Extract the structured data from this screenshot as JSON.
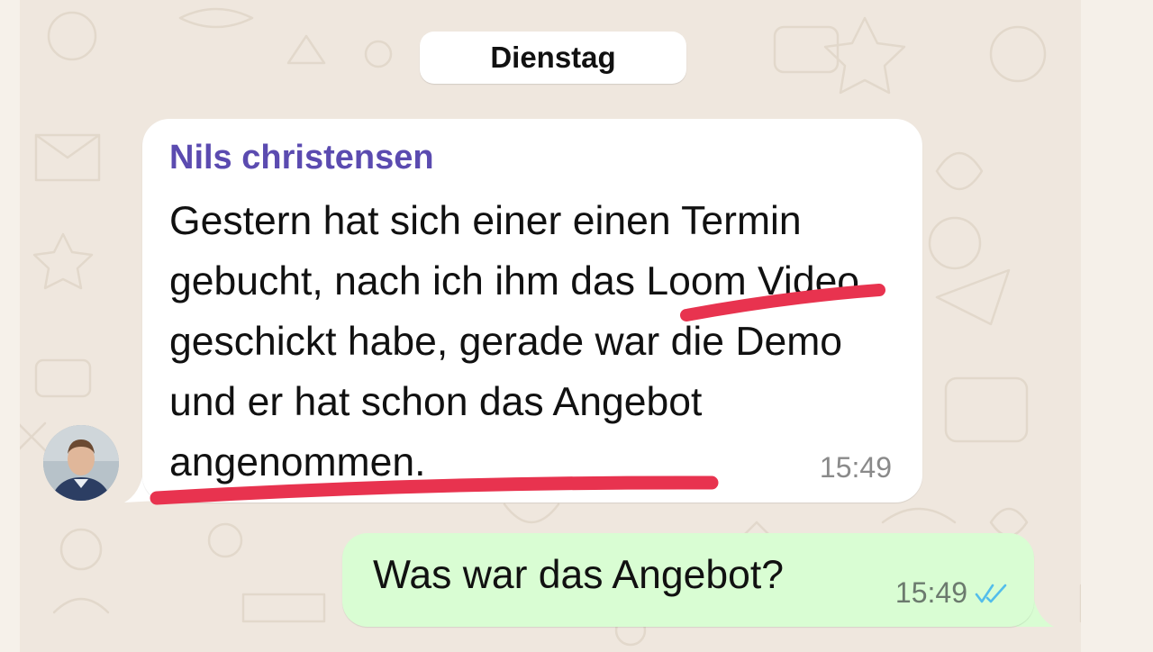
{
  "chat": {
    "date_divider": "Dienstag",
    "incoming": {
      "sender": "Nils christensen",
      "text": "Gestern hat sich einer einen Termin gebucht, nach ich ihm das Loom Video geschickt habe, gerade war die Demo und er hat schon das Angebot angenommen.",
      "time": "15:49"
    },
    "outgoing": {
      "text": "Was war das Angebot?",
      "time": "15:49",
      "status_icon": "double-check-icon"
    }
  },
  "colors": {
    "wallpaper": "#efe7de",
    "incoming_bubble": "#ffffff",
    "outgoing_bubble": "#d9fdd3",
    "sender_name": "#5b4bb0",
    "annotation_underline": "#e8334f",
    "read_ticks": "#53bdeb"
  }
}
